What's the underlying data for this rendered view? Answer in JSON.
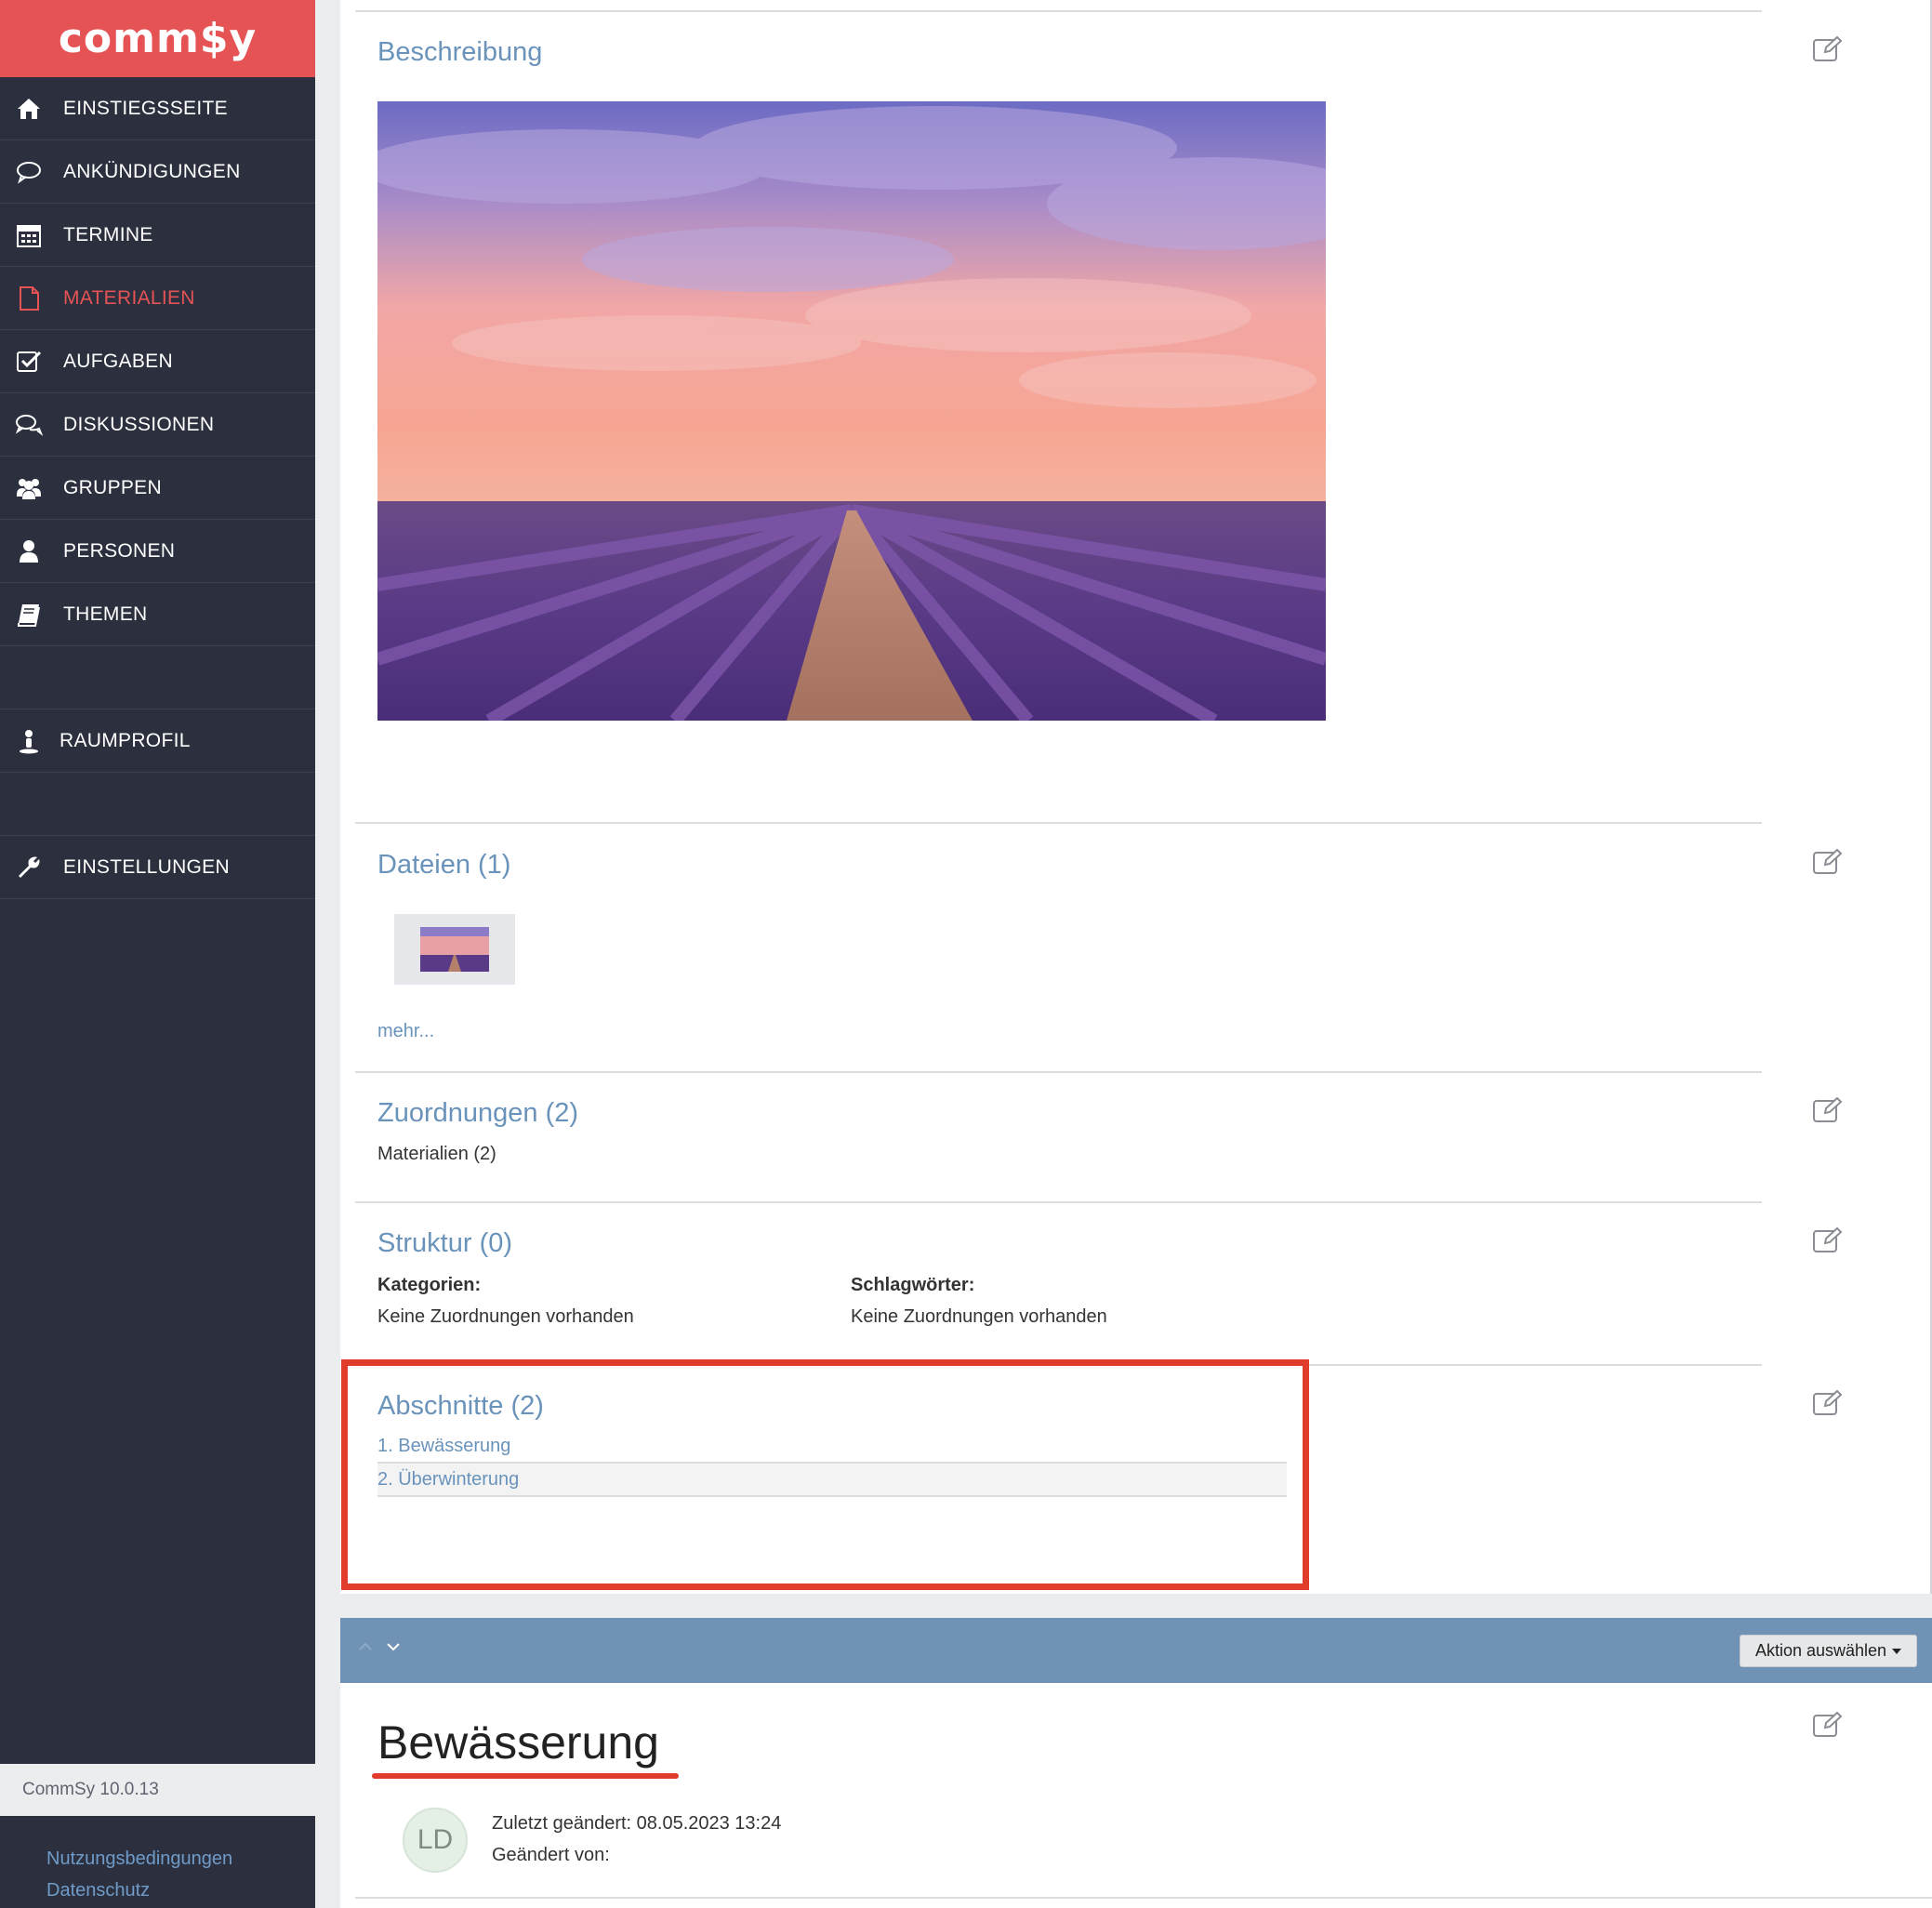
{
  "brand": {
    "logo_text": "comm$y",
    "accent_color": "#e65355"
  },
  "sidebar": {
    "items": [
      {
        "label": "EINSTIEGSSEITE",
        "icon": "home-icon"
      },
      {
        "label": "ANKÜNDIGUNGEN",
        "icon": "speech-bubble-icon"
      },
      {
        "label": "TERMINE",
        "icon": "calendar-icon"
      },
      {
        "label": "MATERIALIEN",
        "icon": "document-icon",
        "active": true
      },
      {
        "label": "AUFGABEN",
        "icon": "checkbox-icon"
      },
      {
        "label": "DISKUSSIONEN",
        "icon": "comments-icon"
      },
      {
        "label": "GRUPPEN",
        "icon": "group-icon"
      },
      {
        "label": "PERSONEN",
        "icon": "person-icon"
      },
      {
        "label": "THEMEN",
        "icon": "book-icon"
      }
    ],
    "room_profile": {
      "label": "RAUMPROFIL",
      "icon": "user-pin-icon"
    },
    "settings": {
      "label": "EINSTELLUNGEN",
      "icon": "wrench-icon"
    },
    "version": "CommSy 10.0.13",
    "links": {
      "terms": "Nutzungsbedingungen",
      "privacy": "Datenschutz"
    }
  },
  "sections": {
    "description": {
      "title": "Beschreibung"
    },
    "files": {
      "title": "Dateien (1)",
      "more": "mehr..."
    },
    "assignments": {
      "title": "Zuordnungen (2)",
      "text": "Materialien (2)"
    },
    "structure": {
      "title": "Struktur (0)",
      "categories_label": "Kategorien:",
      "categories_value": "Keine Zuordnungen vorhanden",
      "tags_label": "Schlagwörter:",
      "tags_value": "Keine Zuordnungen vorhanden"
    },
    "sections_list": {
      "title": "Abschnitte (2)",
      "items": [
        "1. Bewässerung",
        "2. Überwinterung"
      ]
    }
  },
  "section_bar": {
    "action_button": "Aktion auswählen",
    "color": "#7092b4"
  },
  "entry": {
    "title": "Bewässerung",
    "avatar_initials": "LD",
    "modified": "Zuletzt geändert: 08.05.2023 13:24",
    "modified_by": "Geändert von:"
  }
}
